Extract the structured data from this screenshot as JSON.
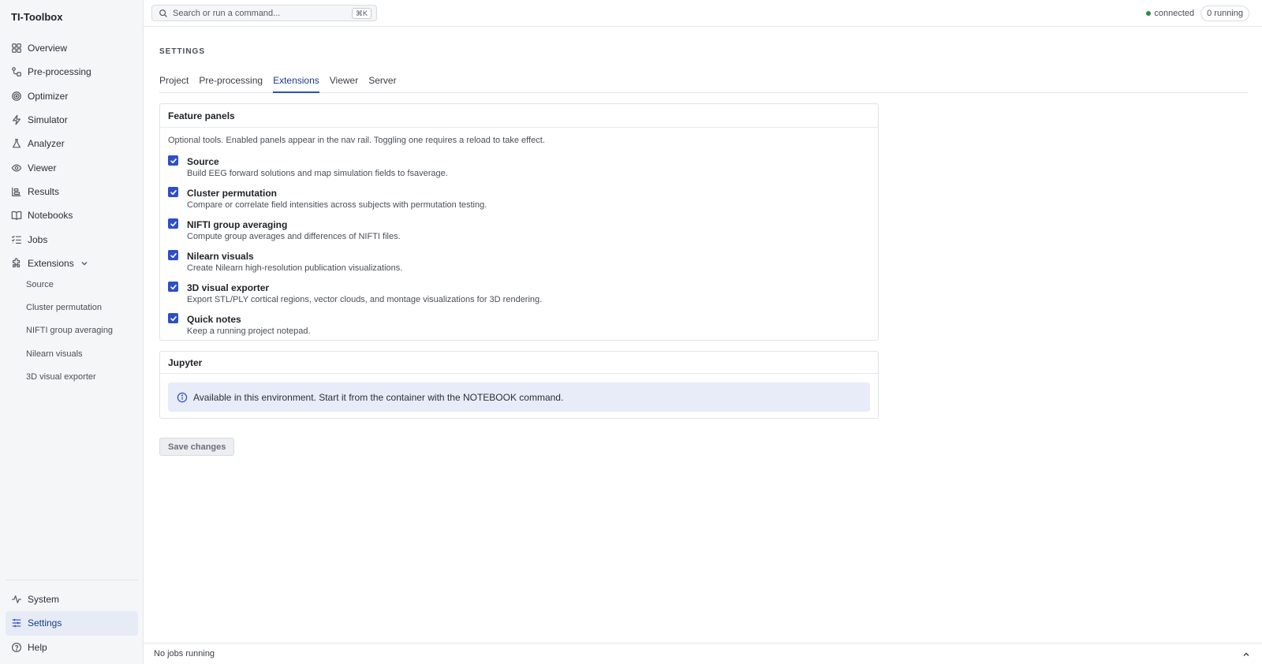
{
  "app": {
    "title": "TI-Toolbox"
  },
  "sidebar": {
    "items": [
      {
        "label": "Overview",
        "icon": "grid-icon"
      },
      {
        "label": "Pre-processing",
        "icon": "workflow-icon"
      },
      {
        "label": "Optimizer",
        "icon": "target-icon"
      },
      {
        "label": "Simulator",
        "icon": "zap-icon"
      },
      {
        "label": "Analyzer",
        "icon": "flask-icon"
      },
      {
        "label": "Viewer",
        "icon": "eye-icon"
      },
      {
        "label": "Results",
        "icon": "chart-icon"
      },
      {
        "label": "Notebooks",
        "icon": "book-icon"
      },
      {
        "label": "Jobs",
        "icon": "list-checks-icon"
      },
      {
        "label": "Extensions",
        "icon": "puzzle-icon",
        "expanded": true
      }
    ],
    "sub_items": [
      "Source",
      "Cluster permutation",
      "NIFTI group averaging",
      "Nilearn visuals",
      "3D visual exporter"
    ],
    "bottom_items": [
      {
        "label": "System",
        "icon": "activity-icon"
      },
      {
        "label": "Settings",
        "icon": "sliders-icon",
        "active": true
      },
      {
        "label": "Help",
        "icon": "help-circle-icon"
      }
    ]
  },
  "topbar": {
    "search_placeholder": "Search or run a command...",
    "shortcut": "⌘K",
    "connection_status": "connected",
    "running_badge": "0 running",
    "status_color": "#2f8a3a"
  },
  "settings": {
    "section_label": "SETTINGS",
    "tabs": [
      "Project",
      "Pre-processing",
      "Extensions",
      "Viewer",
      "Server"
    ],
    "active_tab": "Extensions"
  },
  "feature_panels": {
    "title": "Feature panels",
    "description": "Optional tools. Enabled panels appear in the nav rail. Toggling one requires a reload to take effect.",
    "items": [
      {
        "name": "Source",
        "description": "Build EEG forward solutions and map simulation fields to fsaverage.",
        "checked": true
      },
      {
        "name": "Cluster permutation",
        "description": "Compare or correlate field intensities across subjects with permutation testing.",
        "checked": true
      },
      {
        "name": "NIFTI group averaging",
        "description": "Compute group averages and differences of NIFTI files.",
        "checked": true
      },
      {
        "name": "Nilearn visuals",
        "description": "Create Nilearn high-resolution publication visualizations.",
        "checked": true
      },
      {
        "name": "3D visual exporter",
        "description": "Export STL/PLY cortical regions, vector clouds, and montage visualizations for 3D rendering.",
        "checked": true
      },
      {
        "name": "Quick notes",
        "description": "Keep a running project notepad.",
        "checked": true
      }
    ]
  },
  "jupyter": {
    "title": "Jupyter",
    "info": "Available in this environment. Start it from the container with the NOTEBOOK command."
  },
  "actions": {
    "save_label": "Save changes"
  },
  "footer": {
    "status": "No jobs running"
  },
  "colors": {
    "accent": "#2e4fc8",
    "active_bg": "#e6ebf6",
    "info_bg": "#e7ecf8"
  }
}
